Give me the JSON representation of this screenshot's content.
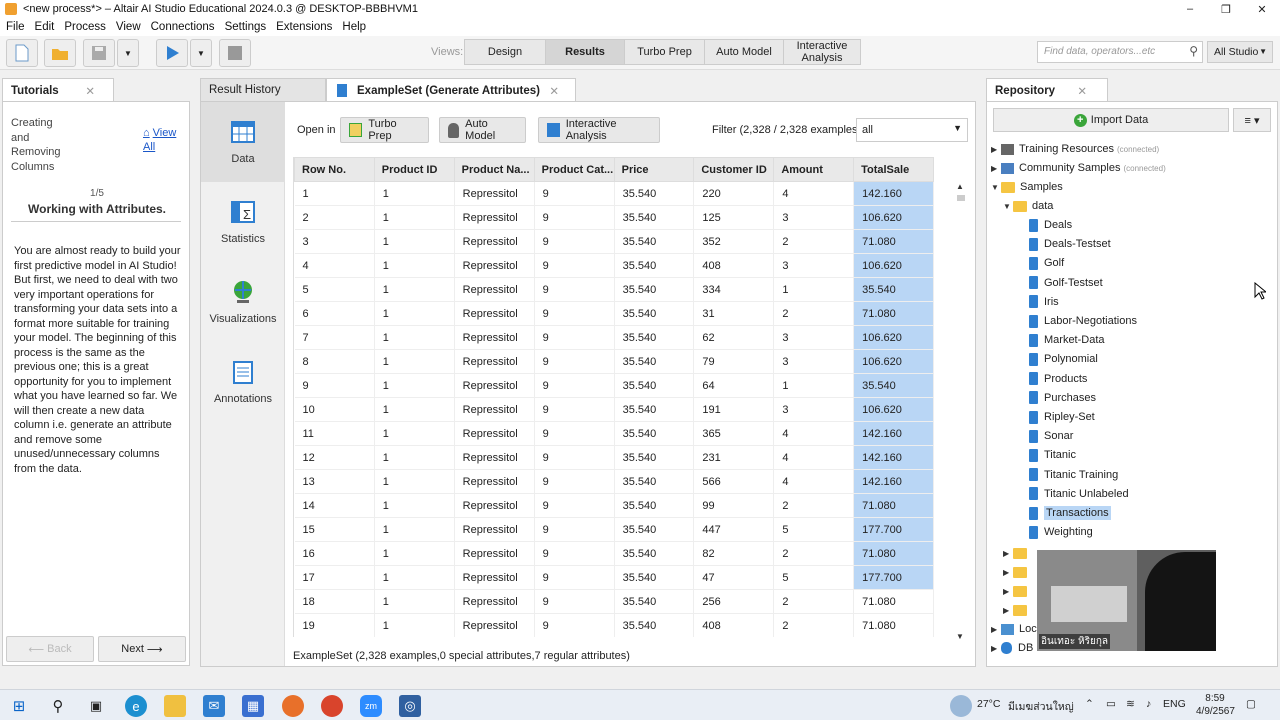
{
  "window": {
    "title": "<new process*> – Altair AI Studio Educational 2024.0.3 @ DESKTOP-BBBHVM1",
    "minimize": "–",
    "maximize": "❐",
    "close": "✕"
  },
  "menu": [
    "File",
    "Edit",
    "Process",
    "View",
    "Connections",
    "Settings",
    "Extensions",
    "Help"
  ],
  "toolbar": {
    "views_label": "Views:",
    "views": [
      "Design",
      "Results",
      "Turbo Prep",
      "Auto Model",
      "Interactive Analysis"
    ],
    "active_view": "Results",
    "search_placeholder": "Find data, operators...etc",
    "studio_select": "All Studio"
  },
  "tutorials": {
    "tab": "Tutorials",
    "heading": "Creating and Removing Columns",
    "view_all": "View All",
    "page": "1/5",
    "title": "Working with Attributes.",
    "body": "You are almost ready to build your first predictive model in AI Studio! But first, we need to deal with two very important operations for transforming your data sets into a format more suitable for training your model. The beginning of this process is the same as the previous one; this is a great opportunity for you to implement what you have learned so far. We will then create a new data column i.e. generate an attribute and remove some unused/unnecessary columns from the data.",
    "back": "Back",
    "next": "Next"
  },
  "results": {
    "history_tab": "Result History",
    "active_tab": "ExampleSet (Generate Attributes)",
    "sidenav": [
      "Data",
      "Statistics",
      "Visualizations",
      "Annotations"
    ],
    "open_in": "Open in",
    "open_buttons": [
      "Turbo Prep",
      "Auto Model",
      "Interactive Analysis"
    ],
    "filter_label": "Filter (2,328 / 2,328 examples):",
    "filter_value": "all",
    "columns": [
      "Row No.",
      "Product ID",
      "Product Na...",
      "Product Cat...",
      "Price",
      "Customer ID",
      "Amount",
      "TotalSale"
    ],
    "rows": [
      [
        "1",
        "1",
        "Repressitol",
        "9",
        "35.540",
        "220",
        "4",
        "142.160"
      ],
      [
        "2",
        "1",
        "Repressitol",
        "9",
        "35.540",
        "125",
        "3",
        "106.620"
      ],
      [
        "3",
        "1",
        "Repressitol",
        "9",
        "35.540",
        "352",
        "2",
        "71.080"
      ],
      [
        "4",
        "1",
        "Repressitol",
        "9",
        "35.540",
        "408",
        "3",
        "106.620"
      ],
      [
        "5",
        "1",
        "Repressitol",
        "9",
        "35.540",
        "334",
        "1",
        "35.540"
      ],
      [
        "6",
        "1",
        "Repressitol",
        "9",
        "35.540",
        "31",
        "2",
        "71.080"
      ],
      [
        "7",
        "1",
        "Repressitol",
        "9",
        "35.540",
        "62",
        "3",
        "106.620"
      ],
      [
        "8",
        "1",
        "Repressitol",
        "9",
        "35.540",
        "79",
        "3",
        "106.620"
      ],
      [
        "9",
        "1",
        "Repressitol",
        "9",
        "35.540",
        "64",
        "1",
        "35.540"
      ],
      [
        "10",
        "1",
        "Repressitol",
        "9",
        "35.540",
        "191",
        "3",
        "106.620"
      ],
      [
        "11",
        "1",
        "Repressitol",
        "9",
        "35.540",
        "365",
        "4",
        "142.160"
      ],
      [
        "12",
        "1",
        "Repressitol",
        "9",
        "35.540",
        "231",
        "4",
        "142.160"
      ],
      [
        "13",
        "1",
        "Repressitol",
        "9",
        "35.540",
        "566",
        "4",
        "142.160"
      ],
      [
        "14",
        "1",
        "Repressitol",
        "9",
        "35.540",
        "99",
        "2",
        "71.080"
      ],
      [
        "15",
        "1",
        "Repressitol",
        "9",
        "35.540",
        "447",
        "5",
        "177.700"
      ],
      [
        "16",
        "1",
        "Repressitol",
        "9",
        "35.540",
        "82",
        "2",
        "71.080"
      ],
      [
        "17",
        "1",
        "Repressitol",
        "9",
        "35.540",
        "47",
        "5",
        "177.700"
      ],
      [
        "18",
        "1",
        "Repressitol",
        "9",
        "35.540",
        "256",
        "2",
        "71.080"
      ],
      [
        "19",
        "1",
        "Repressitol",
        "9",
        "35.540",
        "408",
        "2",
        "71.080"
      ]
    ],
    "selected_rows": 17,
    "status": "ExampleSet (2,328 examples,0 special attributes,7 regular attributes)"
  },
  "repository": {
    "tab": "Repository",
    "import": "Import Data",
    "menu": "≡ ▾",
    "training_resources": "Training Resources",
    "community_samples": "Community Samples",
    "connected": "(connected)",
    "samples": "Samples",
    "data": "data",
    "items": [
      "Deals",
      "Deals-Testset",
      "Golf",
      "Golf-Testset",
      "Iris",
      "Labor-Negotiations",
      "Market-Data",
      "Polynomial",
      "Products",
      "Purchases",
      "Ripley-Set",
      "Sonar",
      "Titanic",
      "Titanic Training",
      "Titanic Unlabeled",
      "Transactions",
      "Weighting"
    ],
    "selected_item": "Transactions",
    "local": "Loca",
    "db": "DB"
  },
  "webcam_caption": "อินเทอะ หิริยกุล",
  "taskbar": {
    "weather": "27°C",
    "weather_text": "มีเมฆส่วนใหญ่",
    "lang": "ENG",
    "time": "8:59",
    "date": "4/9/2567"
  },
  "colors": {
    "selection": "#b9d6f5",
    "link": "#1a56c8",
    "accent_play": "#2f7fd0"
  }
}
